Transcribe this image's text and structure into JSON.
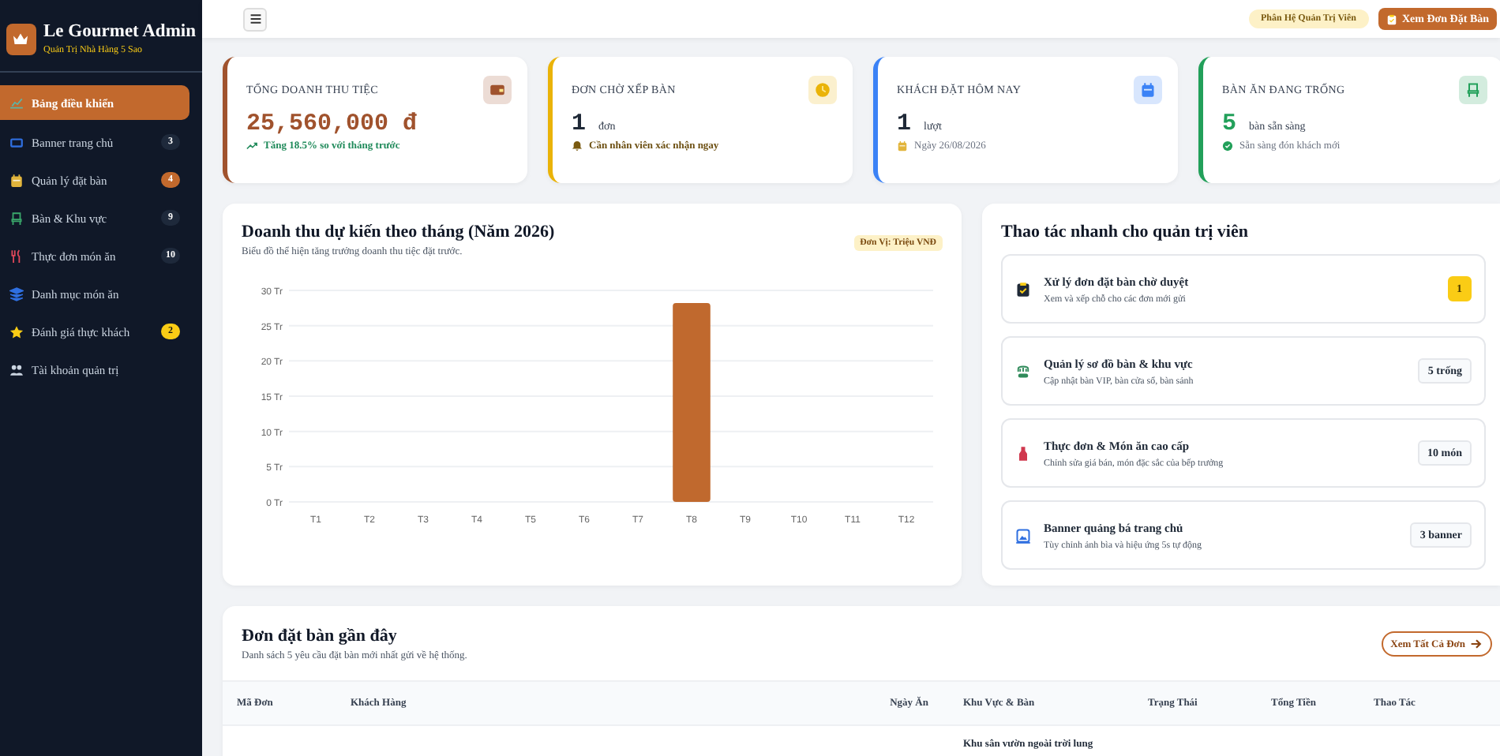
{
  "brand": {
    "title": "Le Gourmet Admin",
    "subtitle": "Quản Trị Nhà Hàng 5 Sao"
  },
  "sidebar": {
    "items": [
      {
        "label": "Bảng điều khiển",
        "selected": true
      },
      {
        "label": "Banner trang chủ",
        "selected": false,
        "count": "3",
        "color": "#1e293b"
      },
      {
        "label": "Quản lý đặt bàn",
        "selected": false,
        "count": "4",
        "color": "#c2692d"
      },
      {
        "label": "Bàn & Khu vực",
        "selected": false,
        "count": "9",
        "color": "#1e293b"
      },
      {
        "label": "Thực đơn món ăn",
        "selected": false,
        "count": "10",
        "color": "#1e293b"
      },
      {
        "label": "Danh mục món ăn",
        "selected": false
      },
      {
        "label": "Đánh giá thực khách",
        "selected": false,
        "count": "2",
        "color": "#facc15"
      },
      {
        "label": "Tài khoản quản trị",
        "selected": false
      }
    ]
  },
  "topbar": {
    "role_badge": "Phân Hệ Quản Trị Viên",
    "action_button": "Xem Đơn Đặt Bàn"
  },
  "stats": [
    {
      "title": "TỔNG DOANH THU TIỆC",
      "value": "25,560,000 đ",
      "color": "#a0522d",
      "note": "Tăng 18.5% so với tháng trước"
    },
    {
      "title": "ĐƠN CHỜ XẾP BÀN",
      "value": "1",
      "unit": "đơn",
      "color": "#eab308",
      "note": "Cần nhân viên xác nhận ngay"
    },
    {
      "title": "KHÁCH ĐẶT HÔM NAY",
      "value": "1",
      "unit": "lượt",
      "color": "#3b82f6",
      "note": "Ngày 26/08/2026"
    },
    {
      "title": "BÀN ĂN ĐANG TRỐNG",
      "value": "5",
      "unit": "bàn sẵn sàng",
      "color": "#22a05a",
      "note": "Sẵn sàng đón khách mới"
    }
  ],
  "revenue": {
    "title": "Doanh thu dự kiến theo tháng (Năm 2026)",
    "subtitle": "Biểu đồ thể hiện tăng trưởng doanh thu tiệc đặt trước.",
    "unit_badge": "Đơn Vị: Triệu VNĐ",
    "chart_data": {
      "type": "bar",
      "grid": true,
      "categories": [
        "T1",
        "T2",
        "T3",
        "T4",
        "T5",
        "T6",
        "T7",
        "T8",
        "T9",
        "T10",
        "T11",
        "T12"
      ],
      "values": [
        0,
        0,
        0,
        0,
        0,
        0,
        0,
        28.2,
        0,
        0,
        0,
        0
      ],
      "ylim": [
        0,
        30
      ],
      "yticks": [
        {
          "value": 0,
          "label": "0 Tr"
        },
        {
          "value": 5,
          "label": "5 Tr"
        },
        {
          "value": 10,
          "label": "10 Tr"
        },
        {
          "value": 15,
          "label": "15 Tr"
        },
        {
          "value": 20,
          "label": "20 Tr"
        },
        {
          "value": 25,
          "label": "25 Tr"
        },
        {
          "value": 30,
          "label": "30 Tr"
        }
      ]
    }
  },
  "quick_actions": {
    "title": "Thao tác nhanh cho quản trị viên",
    "items": [
      {
        "title": "Xử lý đơn đặt bàn chờ duyệt",
        "desc": "Xem và xếp chỗ cho các đơn mới gửi",
        "badge": "1",
        "kind": "highlight"
      },
      {
        "title": "Quản lý sơ đồ bàn & khu vực",
        "desc": "Cập nhật bàn VIP, bàn cửa sổ, bàn sảnh",
        "badge": "5 trống",
        "kind": "plain"
      },
      {
        "title": "Thực đơn & Món ăn cao cấp",
        "desc": "Chỉnh sửa giá bán, món đặc sắc của bếp trưởng",
        "badge": "10 món",
        "kind": "plain"
      },
      {
        "title": "Banner quảng bá trang chủ",
        "desc": "Tùy chỉnh ảnh bìa và hiệu ứng 5s tự động",
        "badge": "3 banner",
        "kind": "plain"
      }
    ]
  },
  "recent": {
    "title": "Đơn đặt bàn gần đây",
    "subtitle": "Danh sách 5 yêu cầu đặt bàn mới nhất gửi về hệ thống.",
    "button": "Xem Tất Cả Đơn",
    "columns": [
      "Mã Đơn",
      "Khách Hàng",
      "Ngày Ăn",
      "Khu Vực & Bàn",
      "Trạng Thái",
      "Tổng Tiền",
      "Thao Tác"
    ],
    "rows": [
      {
        "area": "Khu sân vườn ngoài trời lung"
      }
    ]
  }
}
